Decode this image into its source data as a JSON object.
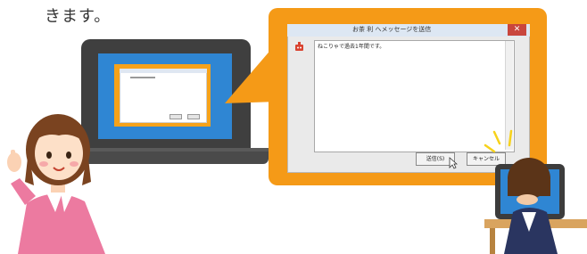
{
  "caption": {
    "text": "きます。"
  },
  "laptop": {
    "screen_color": "#2f86d3",
    "frame_color": "#3f3f3f"
  },
  "callout": {
    "color": "#f59a17"
  },
  "dialog": {
    "title": "お茶 利 へメッセージを送信",
    "close_label": "✕",
    "message": "ねこりゃで過去1年間です。",
    "send_label": "送信(S)",
    "cancel_label": "キャンセル"
  },
  "icons": {
    "app": "app-icon",
    "close": "close-icon",
    "cursor": "mouse-cursor-icon"
  }
}
